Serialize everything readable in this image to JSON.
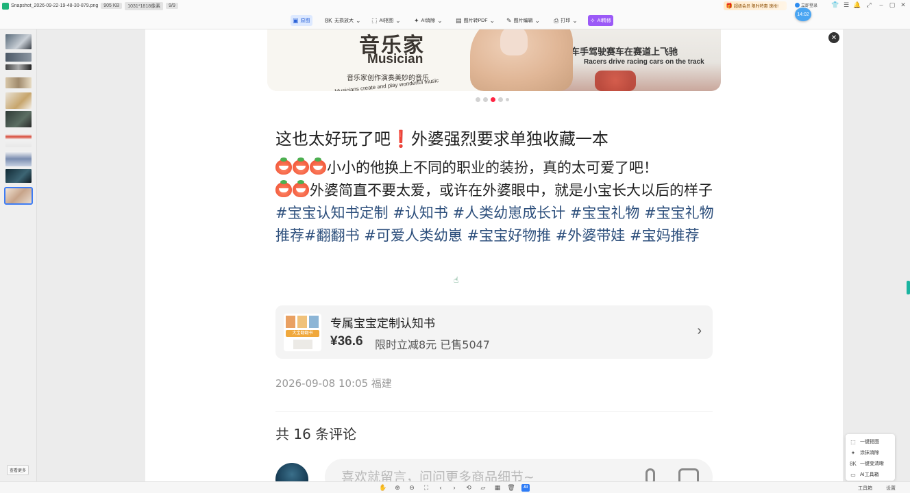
{
  "titlebar": {
    "filename": "Snapshot_2026-09-22-19-48-30-879.png",
    "filesize": "905 KB",
    "resolution": "1031*1818像素",
    "page_index": "9/9",
    "promo": "超级会员 限时特惠 速抢!",
    "login": "立即登录"
  },
  "toolbar": {
    "items": [
      {
        "label": "原图",
        "icon": "image-icon"
      },
      {
        "label": "无损放大",
        "icon": "8k-icon"
      },
      {
        "label": "AI抠图",
        "icon": "crop-icon"
      },
      {
        "label": "AI消除",
        "icon": "magic-wand-icon"
      },
      {
        "label": "图片转PDF",
        "icon": "pdf-icon"
      },
      {
        "label": "图片编辑",
        "icon": "edit-icon"
      },
      {
        "label": "打印",
        "icon": "printer-icon"
      },
      {
        "label": "AI精修",
        "icon": "ai-retouch-icon"
      }
    ],
    "time_badge": "14:02"
  },
  "thumbnails": {
    "more_label": "查看更多",
    "selected_index": 9
  },
  "post": {
    "banner": {
      "cn_big": "音乐家",
      "en_big": "Musician",
      "cn_sm": "音乐家创作演奏美妙的音乐",
      "en_sm": "Musicians create and play wonderful music",
      "cn_right": "赛车手驾驶赛车在赛道上飞驰",
      "en_right": "Racers drive racing cars on the track"
    },
    "title_a": "这也太好玩了吧",
    "title_mark": "❗",
    "title_b": "外婆强烈要求单独收藏一本",
    "line1": "小小的他换上不同的职业的装扮，真的太可爱了吧！",
    "line2": "外婆简直不要太爱，或许在外婆眼中，就是小宝长大以后的样子",
    "tags": "#宝宝认知书定制 #认知书 #人类幼崽成长计 #宝宝礼物 #宝宝礼物推荐#翻翻书 #可爱人类幼崽 #宝宝好物推 #外婆带娃 #宝妈推荐",
    "product": {
      "name": "专属宝宝定制认知书",
      "img_text": "大宝翻翻书",
      "price": "¥36.6",
      "promo": "限时立减8元  已售5047"
    },
    "meta": "2026-09-08 10:05 福建",
    "comments_heading": "共 16 条评论",
    "comment_placeholder": "喜欢就留言，问问更多商品细节~"
  },
  "float_menu": [
    {
      "label": "一键抠图",
      "icon": "crop-icon"
    },
    {
      "label": "涂抹消除",
      "icon": "magic-wand-icon"
    },
    {
      "label": "一键变清晰",
      "icon": "8k-icon"
    },
    {
      "label": "AI工具箱",
      "icon": "toolbox-icon"
    }
  ],
  "bottombar": {
    "ai_label": "AI",
    "toolbox_label": "工具箱",
    "settings_label": "设置"
  }
}
